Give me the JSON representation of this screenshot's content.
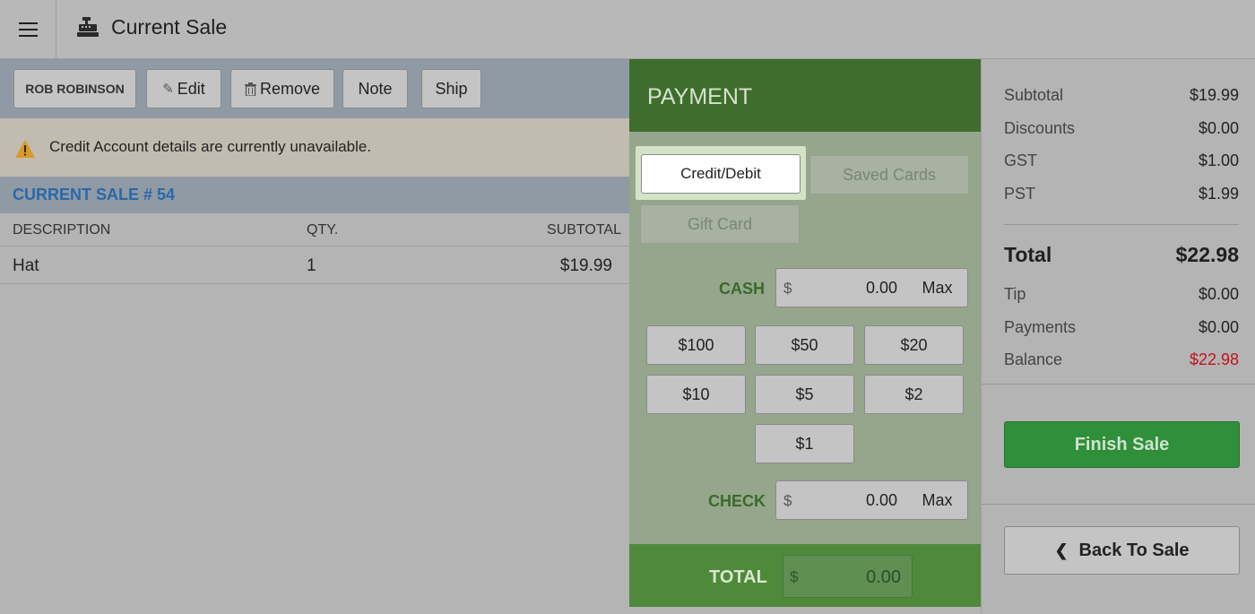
{
  "header": {
    "title": "Current Sale",
    "menu_icon": "hamburger-icon",
    "register_icon": "cash-register-icon"
  },
  "toolbar": {
    "customer_label": "ROB ROBINSON",
    "edit_label": "Edit",
    "remove_label": "Remove",
    "note_label": "Note",
    "ship_label": "Ship"
  },
  "alert": {
    "text": "Credit Account details are currently unavailable.",
    "icon": "warning-icon",
    "icon_color": "#d79a2b"
  },
  "sale": {
    "title": "CURRENT SALE # 54",
    "columns": [
      "DESCRIPTION",
      "QTY.",
      "SUBTOTAL"
    ],
    "rows": [
      {
        "description": "Hat",
        "qty": "1",
        "subtotal": "$19.99"
      }
    ]
  },
  "payment": {
    "title": "PAYMENT",
    "credit_label": "Credit/Debit",
    "saved_cards_label": "Saved Cards",
    "gift_card_label": "Gift Card",
    "cash_label": "CASH",
    "cash_currency": "$",
    "cash_value": "0.00",
    "max_label": "Max",
    "quick_cash": [
      "$100",
      "$50",
      "$20",
      "$10",
      "$5",
      "$2",
      "$1"
    ],
    "check_label": "CHECK",
    "check_currency": "$",
    "check_value": "0.00",
    "total_label": "TOTAL",
    "total_currency": "$",
    "total_value": "0.00"
  },
  "summary": {
    "subtotal_label": "Subtotal",
    "subtotal_value": "$19.99",
    "discounts_label": "Discounts",
    "discounts_value": "$0.00",
    "gst_label": "GST",
    "gst_value": "$1.00",
    "pst_label": "PST",
    "pst_value": "$1.99",
    "total_label": "Total",
    "total_value": "$22.98",
    "tip_label": "Tip",
    "tip_value": "$0.00",
    "payments_label": "Payments",
    "payments_value": "$0.00",
    "balance_label": "Balance",
    "balance_value": "$22.98",
    "balance_color": "#c0141c",
    "finish_label": "Finish Sale",
    "back_label": "Back To Sale"
  },
  "colors": {
    "accent_green": "#2f8f3a",
    "payment_header": "#3f6d2d",
    "sale_title_blue": "#2a68a8"
  }
}
